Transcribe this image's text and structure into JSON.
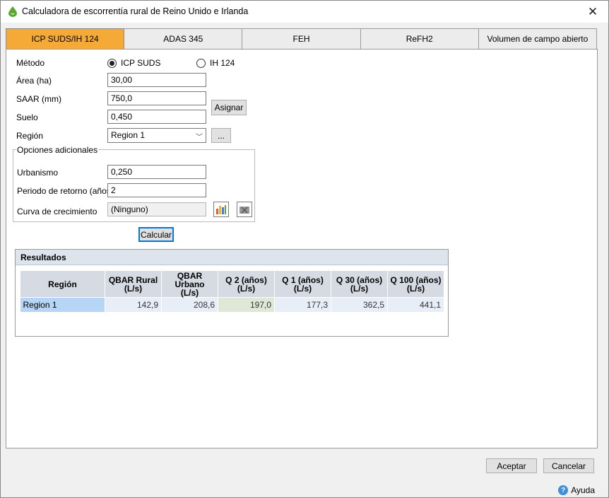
{
  "window": {
    "title": "Calculadora de escorrentía rural de Reino Unido e Irlanda"
  },
  "tabs": [
    "ICP SUDS/IH 124",
    "ADAS 345",
    "FEH",
    "ReFH2",
    "Volumen de campo abierto"
  ],
  "form": {
    "method_label": "Método",
    "method_options": [
      "ICP SUDS",
      "IH 124"
    ],
    "area_label": "Área (ha)",
    "area_value": "30,00",
    "saar_label": "SAAR (mm)",
    "saar_value": "750,0",
    "soil_label": "Suelo",
    "soil_value": "0,450",
    "assign_label": "Asignar",
    "region_label": "Región",
    "region_value": "Region 1",
    "ellipsis_label": "...",
    "group_title": "Opciones adicionales",
    "urban_label": "Urbanismo",
    "urban_value": "0,250",
    "return_label": "Periodo de retorno (años)",
    "return_value": "2",
    "growth_label": "Curva de crecimiento",
    "growth_value": "(Ninguno)",
    "calculate_label": "Calcular"
  },
  "results": {
    "title": "Resultados",
    "headers": [
      "Región",
      "QBAR Rural\n(L/s)",
      "QBAR Urbano\n(L/s)",
      "Q 2 (años)\n(L/s)",
      "Q 1 (años)\n(L/s)",
      "Q 30 (años)\n(L/s)",
      "Q 100 (años)\n(L/s)"
    ],
    "rows": [
      [
        "Region 1",
        "142,9",
        "208,6",
        "197,0",
        "177,3",
        "362,5",
        "441,1"
      ]
    ]
  },
  "footer": {
    "ok_label": "Aceptar",
    "cancel_label": "Cancelar",
    "help_label": "Ayuda"
  },
  "colors": {
    "active_tab": "#f5a937",
    "focus": "#0078d7"
  }
}
